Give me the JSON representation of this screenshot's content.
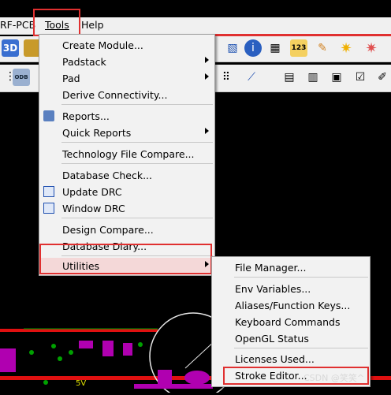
{
  "menubar": {
    "app_fragment": "RF-PCB",
    "tools": "Tools",
    "help": "Help"
  },
  "toolbar_top": {
    "icon_123_label": "123"
  },
  "toolbar_second": {
    "odb_label": "ODB"
  },
  "tools_menu": {
    "items": [
      {
        "label": "Create Module...",
        "has_submenu": false
      },
      {
        "label": "Padstack",
        "has_submenu": true
      },
      {
        "label": "Pad",
        "has_submenu": true
      },
      {
        "label": "Derive Connectivity...",
        "has_submenu": false
      },
      {
        "label": "Reports...",
        "has_submenu": false
      },
      {
        "label": "Quick Reports",
        "has_submenu": true
      },
      {
        "label": "Technology File Compare...",
        "has_submenu": false
      },
      {
        "label": "Database Check...",
        "has_submenu": false
      },
      {
        "label": "Update DRC",
        "has_submenu": false
      },
      {
        "label": "Window DRC",
        "has_submenu": false
      },
      {
        "label": "Design Compare...",
        "has_submenu": false
      },
      {
        "label": "Database Diary...",
        "has_submenu": false
      },
      {
        "label": "Utilities",
        "has_submenu": true,
        "highlighted": true
      }
    ]
  },
  "utilities_menu": {
    "items": [
      {
        "label": "File Manager..."
      },
      {
        "label": "Env Variables..."
      },
      {
        "label": "Aliases/Function Keys..."
      },
      {
        "label": "Keyboard Commands"
      },
      {
        "label": "OpenGL Status"
      },
      {
        "label": "Licenses Used..."
      },
      {
        "label": "Stroke Editor..."
      }
    ]
  },
  "canvas": {
    "net_label": "5V"
  },
  "watermark": "CSDN @笑笑^",
  "colors": {
    "highlight_red": "#e03030",
    "menu_bg": "#f2f2f2",
    "hover_bg": "#cce0f7",
    "canvas_bg": "#000000",
    "pcb_magenta": "#b000b0",
    "pcb_green": "#00a000"
  }
}
